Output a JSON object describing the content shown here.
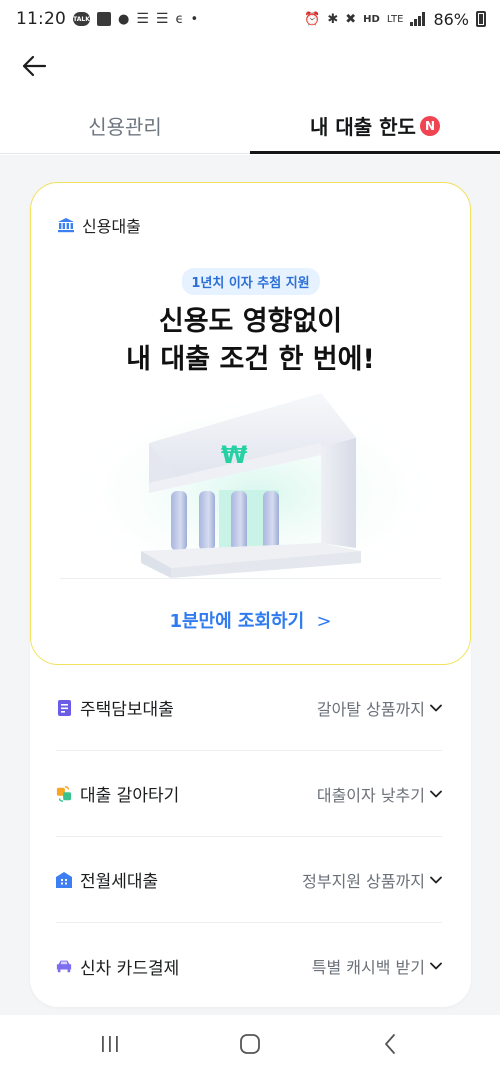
{
  "status_bar": {
    "time": "11:20",
    "battery_percent": "86%",
    "network_hd": "HD",
    "network_lte": "LTE"
  },
  "back_icon": "arrow-left-icon",
  "tabs": [
    {
      "label": "신용관리",
      "active": false
    },
    {
      "label": "내 대출 한도",
      "active": true,
      "badge": "N"
    }
  ],
  "hero": {
    "category_label": "신용대출",
    "pill": "1년치 이자 추첨 지원",
    "title_line1": "신용도 영향없이",
    "title_line2": "내 대출 조건 한 번에!",
    "cta": "1분만에 조회하기",
    "cta_arrow": ">",
    "accent_color": "#2f7bf0",
    "border_color": "#f2e15c"
  },
  "list": [
    {
      "icon": "document-icon",
      "icon_color": "#6b5ce7",
      "label": "주택담보대출",
      "action": "갈아탈 상품까지"
    },
    {
      "icon": "refresh-icon",
      "icon_color": "#f5a623",
      "label": "대출 갈아타기",
      "action": "대출이자 낮추기"
    },
    {
      "icon": "building-icon",
      "icon_color": "#3d7ff2",
      "label": "전월세대출",
      "action": "정부지원 상품까지"
    },
    {
      "icon": "car-icon",
      "icon_color": "#7c6cf0",
      "label": "신차 카드결제",
      "action": "특별 캐시백 받기"
    }
  ]
}
